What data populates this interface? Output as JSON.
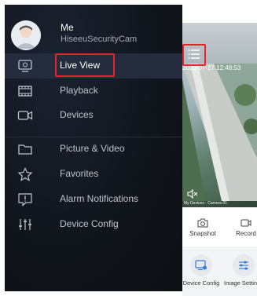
{
  "user": {
    "name": "Me",
    "app_name": "HiseeuSecurityCam"
  },
  "menu": [
    {
      "id": "live-view",
      "label": "Live View",
      "icon": "monitor-icon",
      "active": true
    },
    {
      "id": "playback",
      "label": "Playback",
      "icon": "film-icon",
      "active": false
    },
    {
      "id": "devices",
      "label": "Devices",
      "icon": "camera-icon",
      "active": false
    },
    {
      "id": "picture-video",
      "label": "Picture & Video",
      "icon": "folder-icon",
      "active": false
    },
    {
      "id": "favorites",
      "label": "Favorites",
      "icon": "star-icon",
      "active": false
    },
    {
      "id": "alarm-notifications",
      "label": "Alarm Notifications",
      "icon": "alert-icon",
      "active": false
    },
    {
      "id": "device-config",
      "label": "Device Config",
      "icon": "sliders-icon",
      "active": false
    }
  ],
  "live": {
    "timestamp": "2023-07-27 12:48:53",
    "camera_label": "My Devices - Camera 01",
    "actions": [
      {
        "label": "Snapshot",
        "icon": "camera-outline-icon"
      },
      {
        "label": "Record",
        "icon": "video-record-icon"
      }
    ],
    "tiles": [
      {
        "label": "Device Config",
        "icon": "device-config-icon"
      },
      {
        "label": "Image Settings",
        "icon": "image-settings-icon"
      }
    ]
  },
  "colors": {
    "accent_red": "#e0262b",
    "drawer_bg": "#11151c",
    "active_bg": "#252c3d"
  }
}
